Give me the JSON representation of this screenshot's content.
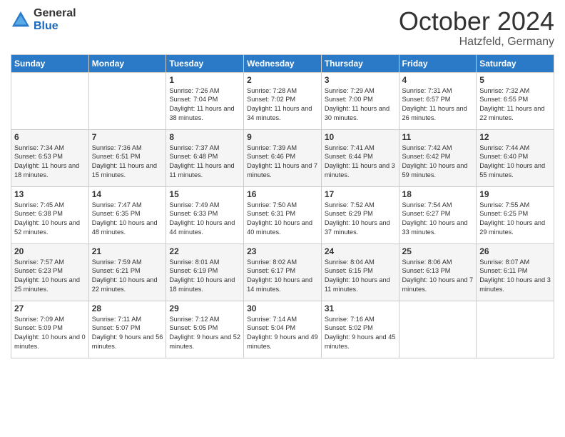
{
  "logo": {
    "general": "General",
    "blue": "Blue"
  },
  "title": "October 2024",
  "subtitle": "Hatzfeld, Germany",
  "days_of_week": [
    "Sunday",
    "Monday",
    "Tuesday",
    "Wednesday",
    "Thursday",
    "Friday",
    "Saturday"
  ],
  "weeks": [
    [
      {
        "day": "",
        "info": ""
      },
      {
        "day": "",
        "info": ""
      },
      {
        "day": "1",
        "info": "Sunrise: 7:26 AM\nSunset: 7:04 PM\nDaylight: 11 hours and 38 minutes."
      },
      {
        "day": "2",
        "info": "Sunrise: 7:28 AM\nSunset: 7:02 PM\nDaylight: 11 hours and 34 minutes."
      },
      {
        "day": "3",
        "info": "Sunrise: 7:29 AM\nSunset: 7:00 PM\nDaylight: 11 hours and 30 minutes."
      },
      {
        "day": "4",
        "info": "Sunrise: 7:31 AM\nSunset: 6:57 PM\nDaylight: 11 hours and 26 minutes."
      },
      {
        "day": "5",
        "info": "Sunrise: 7:32 AM\nSunset: 6:55 PM\nDaylight: 11 hours and 22 minutes."
      }
    ],
    [
      {
        "day": "6",
        "info": "Sunrise: 7:34 AM\nSunset: 6:53 PM\nDaylight: 11 hours and 18 minutes."
      },
      {
        "day": "7",
        "info": "Sunrise: 7:36 AM\nSunset: 6:51 PM\nDaylight: 11 hours and 15 minutes."
      },
      {
        "day": "8",
        "info": "Sunrise: 7:37 AM\nSunset: 6:48 PM\nDaylight: 11 hours and 11 minutes."
      },
      {
        "day": "9",
        "info": "Sunrise: 7:39 AM\nSunset: 6:46 PM\nDaylight: 11 hours and 7 minutes."
      },
      {
        "day": "10",
        "info": "Sunrise: 7:41 AM\nSunset: 6:44 PM\nDaylight: 11 hours and 3 minutes."
      },
      {
        "day": "11",
        "info": "Sunrise: 7:42 AM\nSunset: 6:42 PM\nDaylight: 10 hours and 59 minutes."
      },
      {
        "day": "12",
        "info": "Sunrise: 7:44 AM\nSunset: 6:40 PM\nDaylight: 10 hours and 55 minutes."
      }
    ],
    [
      {
        "day": "13",
        "info": "Sunrise: 7:45 AM\nSunset: 6:38 PM\nDaylight: 10 hours and 52 minutes."
      },
      {
        "day": "14",
        "info": "Sunrise: 7:47 AM\nSunset: 6:35 PM\nDaylight: 10 hours and 48 minutes."
      },
      {
        "day": "15",
        "info": "Sunrise: 7:49 AM\nSunset: 6:33 PM\nDaylight: 10 hours and 44 minutes."
      },
      {
        "day": "16",
        "info": "Sunrise: 7:50 AM\nSunset: 6:31 PM\nDaylight: 10 hours and 40 minutes."
      },
      {
        "day": "17",
        "info": "Sunrise: 7:52 AM\nSunset: 6:29 PM\nDaylight: 10 hours and 37 minutes."
      },
      {
        "day": "18",
        "info": "Sunrise: 7:54 AM\nSunset: 6:27 PM\nDaylight: 10 hours and 33 minutes."
      },
      {
        "day": "19",
        "info": "Sunrise: 7:55 AM\nSunset: 6:25 PM\nDaylight: 10 hours and 29 minutes."
      }
    ],
    [
      {
        "day": "20",
        "info": "Sunrise: 7:57 AM\nSunset: 6:23 PM\nDaylight: 10 hours and 25 minutes."
      },
      {
        "day": "21",
        "info": "Sunrise: 7:59 AM\nSunset: 6:21 PM\nDaylight: 10 hours and 22 minutes."
      },
      {
        "day": "22",
        "info": "Sunrise: 8:01 AM\nSunset: 6:19 PM\nDaylight: 10 hours and 18 minutes."
      },
      {
        "day": "23",
        "info": "Sunrise: 8:02 AM\nSunset: 6:17 PM\nDaylight: 10 hours and 14 minutes."
      },
      {
        "day": "24",
        "info": "Sunrise: 8:04 AM\nSunset: 6:15 PM\nDaylight: 10 hours and 11 minutes."
      },
      {
        "day": "25",
        "info": "Sunrise: 8:06 AM\nSunset: 6:13 PM\nDaylight: 10 hours and 7 minutes."
      },
      {
        "day": "26",
        "info": "Sunrise: 8:07 AM\nSunset: 6:11 PM\nDaylight: 10 hours and 3 minutes."
      }
    ],
    [
      {
        "day": "27",
        "info": "Sunrise: 7:09 AM\nSunset: 5:09 PM\nDaylight: 10 hours and 0 minutes."
      },
      {
        "day": "28",
        "info": "Sunrise: 7:11 AM\nSunset: 5:07 PM\nDaylight: 9 hours and 56 minutes."
      },
      {
        "day": "29",
        "info": "Sunrise: 7:12 AM\nSunset: 5:05 PM\nDaylight: 9 hours and 52 minutes."
      },
      {
        "day": "30",
        "info": "Sunrise: 7:14 AM\nSunset: 5:04 PM\nDaylight: 9 hours and 49 minutes."
      },
      {
        "day": "31",
        "info": "Sunrise: 7:16 AM\nSunset: 5:02 PM\nDaylight: 9 hours and 45 minutes."
      },
      {
        "day": "",
        "info": ""
      },
      {
        "day": "",
        "info": ""
      }
    ]
  ]
}
